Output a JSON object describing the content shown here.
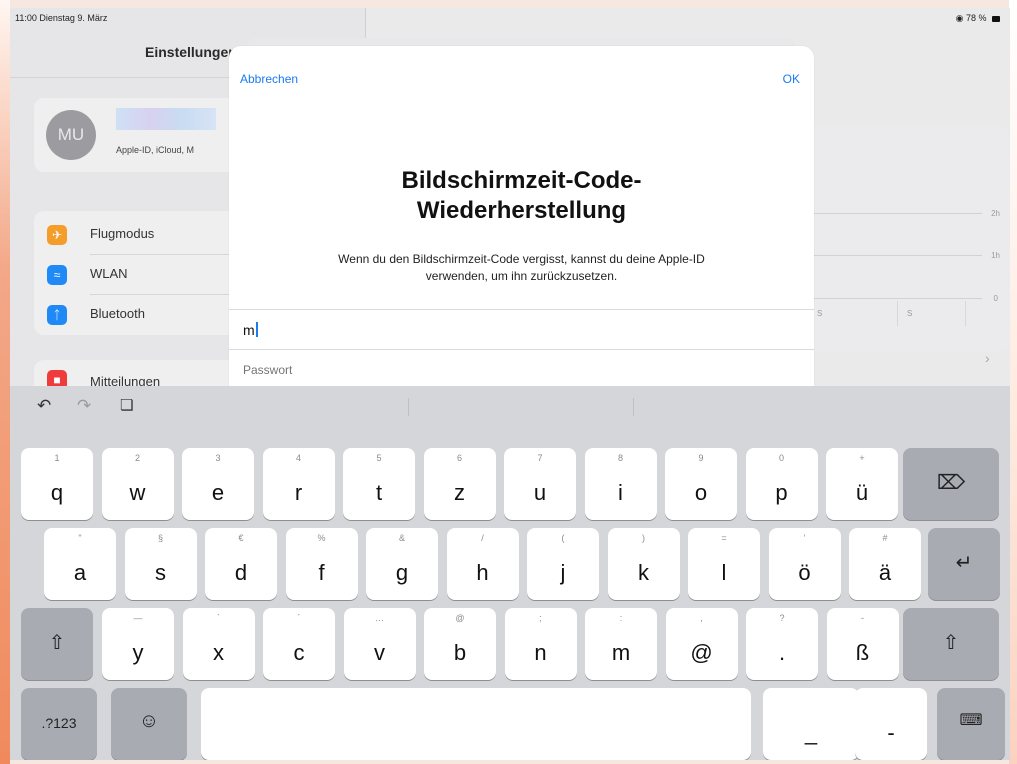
{
  "status": {
    "time_date": "11:00  Dienstag 9. März",
    "battery": "78 %"
  },
  "settings": {
    "title": "Einstellungen",
    "profile": {
      "initials": "MU",
      "subtitle": "Apple-ID, iCloud, M"
    },
    "items": [
      {
        "label": "Flugmodus",
        "icon": "airplane-icon",
        "color": "#f59d2a"
      },
      {
        "label": "WLAN",
        "icon": "wifi-icon",
        "color": "#1f8af5"
      },
      {
        "label": "Bluetooth",
        "icon": "bluetooth-icon",
        "color": "#1f8af5"
      }
    ],
    "notifications_label": "Mitteilungen"
  },
  "usage_panel": {
    "labels": [
      "2h",
      "1h",
      "0"
    ],
    "days": [
      "S",
      "S"
    ]
  },
  "modal": {
    "cancel": "Abbrechen",
    "ok": "OK",
    "title_line1": "Bildschirmzeit-Code-",
    "title_line2": "Wiederherstellung",
    "description_line1": "Wenn du den Bildschirmzeit-Code vergisst, kannst du deine Apple-ID",
    "description_line2": "verwenden, um ihn zurückzusetzen.",
    "apple_id_value": "m",
    "password_placeholder": "Passwort"
  },
  "keyboard": {
    "toolbar": [
      "undo-icon",
      "redo-icon",
      "clipboard-icon"
    ],
    "row1": [
      {
        "hint": "1",
        "ch": "q"
      },
      {
        "hint": "2",
        "ch": "w"
      },
      {
        "hint": "3",
        "ch": "e"
      },
      {
        "hint": "4",
        "ch": "r"
      },
      {
        "hint": "5",
        "ch": "t"
      },
      {
        "hint": "6",
        "ch": "z"
      },
      {
        "hint": "7",
        "ch": "u"
      },
      {
        "hint": "8",
        "ch": "i"
      },
      {
        "hint": "9",
        "ch": "o"
      },
      {
        "hint": "0",
        "ch": "p"
      },
      {
        "hint": "+",
        "ch": "ü"
      }
    ],
    "row2": [
      {
        "hint": "\"",
        "ch": "a"
      },
      {
        "hint": "§",
        "ch": "s"
      },
      {
        "hint": "€",
        "ch": "d"
      },
      {
        "hint": "%",
        "ch": "f"
      },
      {
        "hint": "&",
        "ch": "g"
      },
      {
        "hint": "/",
        "ch": "h"
      },
      {
        "hint": "(",
        "ch": "j"
      },
      {
        "hint": ")",
        "ch": "k"
      },
      {
        "hint": "=",
        "ch": "l"
      },
      {
        "hint": "’",
        "ch": "ö"
      },
      {
        "hint": "#",
        "ch": "ä"
      }
    ],
    "row3": [
      {
        "hint": "—",
        "ch": "y"
      },
      {
        "hint": "`",
        "ch": "x"
      },
      {
        "hint": "´",
        "ch": "c"
      },
      {
        "hint": "…",
        "ch": "v"
      },
      {
        "hint": "@",
        "ch": "b"
      },
      {
        "hint": ";",
        "ch": "n"
      },
      {
        "hint": ":",
        "ch": "m"
      },
      {
        "hint": ",",
        "ch": "@"
      },
      {
        "hint": "?",
        "ch": "."
      },
      {
        "hint": "-",
        "ch": "ß"
      }
    ],
    "numbers_label": ".?123",
    "underscore": "_",
    "dash": "-"
  }
}
